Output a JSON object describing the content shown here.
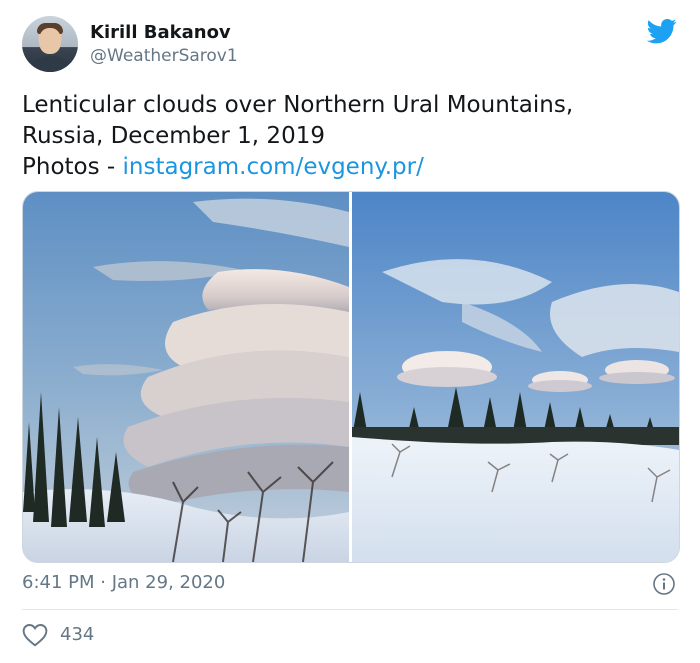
{
  "author": {
    "name": "Kirill Bakanov",
    "handle": "@WeatherSarov1"
  },
  "tweet": {
    "line1": "Lenticular clouds over Northern Ural Mountains,",
    "line2": "Russia, December 1, 2019",
    "line3_prefix": "Photos - ",
    "link_text": "instagram.com/evgeny.pr/"
  },
  "media": {
    "photos": [
      "lenticular-cloud-photo-left",
      "lenticular-cloud-photo-right"
    ]
  },
  "footer": {
    "timestamp": "6:41 PM · Jan 29, 2020",
    "like_count": "434"
  },
  "colors": {
    "link": "#1b95e0",
    "twitter_blue": "#1da1f2",
    "secondary_text": "#657786"
  },
  "icons": {
    "brand": "twitter-bird-icon",
    "info": "info-icon",
    "like": "heart-icon"
  }
}
